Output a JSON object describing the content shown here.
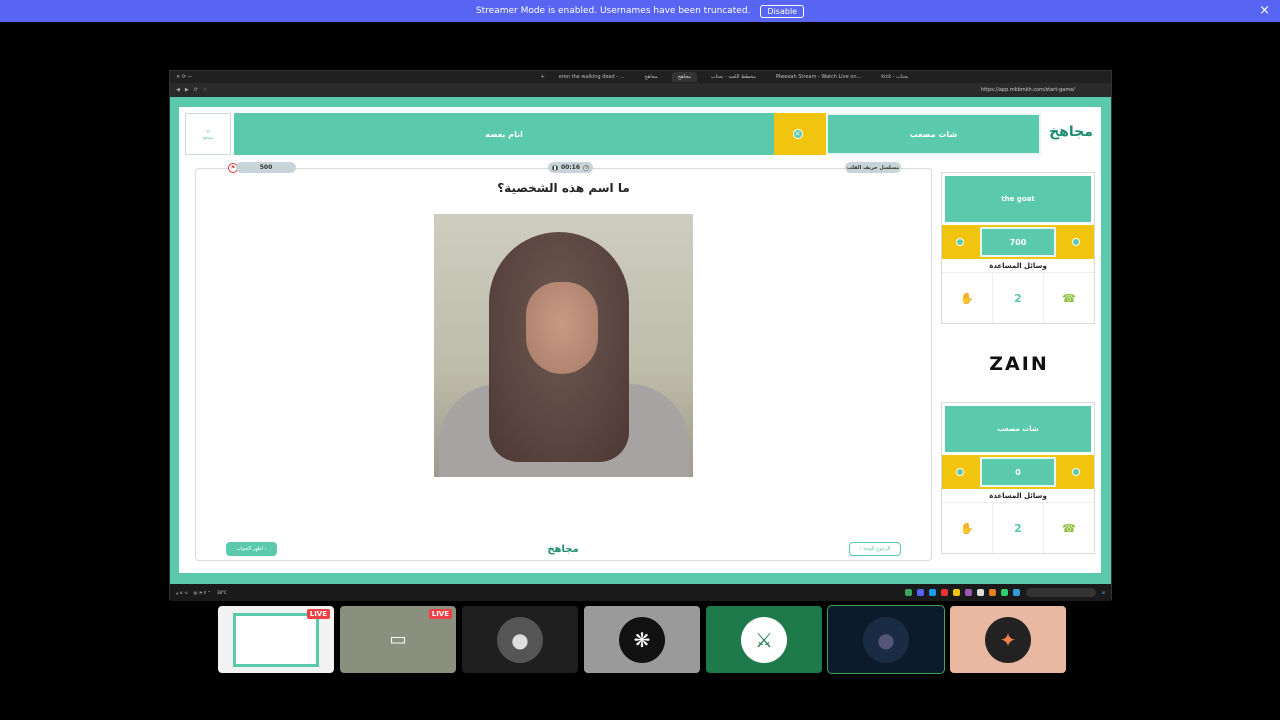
{
  "banner": {
    "message": "Streamer Mode is enabled. Usernames have been truncated.",
    "disable_label": "Disable",
    "close_icon": "×"
  },
  "browser": {
    "tabs": [
      {
        "label": "eren the walking dead - ...",
        "active": false
      },
      {
        "label": "مجاهخ",
        "active": false
      },
      {
        "label": "مجاهخ",
        "active": true
      },
      {
        "label": "مخطط اللعبة - بحثات",
        "active": false
      },
      {
        "label": "Mweeah Stream - Watch Live on...",
        "active": false
      },
      {
        "label": "kick - بحثات",
        "active": false
      }
    ],
    "url": "https://app.mkbmkh.com/start-game/"
  },
  "game": {
    "logo_text": "مجاهخ",
    "menu_label": "☰",
    "menu_caption": "مجاهخ",
    "team_right_name": "شات مصعب",
    "team_left_name": "انام بعصه",
    "points_pill": "500",
    "timer": "00:16",
    "category": "مسلسل خريف القلب",
    "question": "ما اسم هذه الشخصية؟",
    "show_answer_label": "اظهر الجواب ›",
    "back_label": "‹ الرجوع للوحة",
    "footer_logo": "مجاهخ",
    "sponsor": "ZAIN"
  },
  "teams": [
    {
      "name": "the goat",
      "score": "700",
      "aids_title": "وسائل المساعدة"
    },
    {
      "name": "شات مصعب",
      "score": "0",
      "aids_title": "وسائل المساعدة"
    }
  ],
  "aid_icons": [
    "hand-icon",
    "double-points-icon",
    "phone-icon"
  ],
  "aid_glyphs": [
    "✋",
    "2",
    "☎"
  ],
  "taskbar": {
    "weather": "38°C",
    "time": "٥:٠٥ م"
  },
  "tiles": [
    {
      "kind": "stream",
      "live_label": "LIVE",
      "color": "#f2f2f2"
    },
    {
      "kind": "stream",
      "live_label": "LIVE",
      "color": "#8a8f7e"
    },
    {
      "kind": "avatar",
      "color": "#1e1e1e"
    },
    {
      "kind": "avatar",
      "color": "#9a9a9a"
    },
    {
      "kind": "avatar",
      "color": "#1e7a4a"
    },
    {
      "kind": "avatar",
      "color": "#0d1a2a"
    },
    {
      "kind": "avatar",
      "color": "#e8b8a0"
    }
  ],
  "colors": {
    "teal": "#5bc9ab",
    "gold": "#f1c40f",
    "banner": "#5865f2",
    "live": "#ed4245"
  }
}
